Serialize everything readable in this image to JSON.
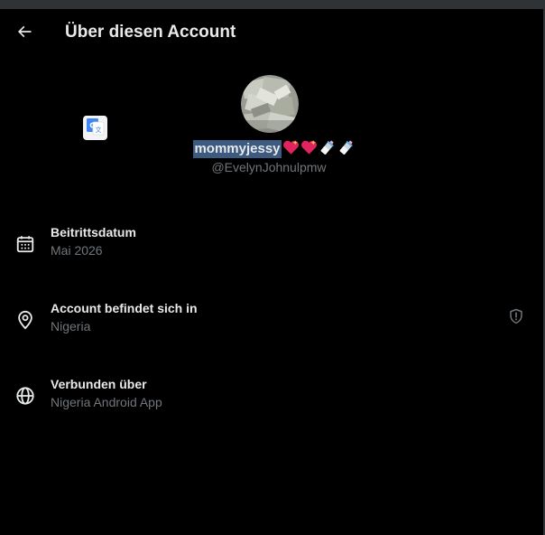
{
  "header": {
    "title": "Über diesen Account",
    "back_icon": "arrow-left-icon"
  },
  "profile": {
    "display_name": "mommyjessy",
    "name_emojis": [
      "💖",
      "💖",
      "🍼",
      "🍼"
    ],
    "handle": "@EvelynJohnulpmw",
    "avatar_icon": "profile-photo"
  },
  "translate": {
    "icon": "google-translate-icon"
  },
  "details": [
    {
      "icon": "calendar-icon",
      "label": "Beitrittsdatum",
      "value": "Mai 2026"
    },
    {
      "icon": "location-pin-icon",
      "label": "Account befindet sich in",
      "value": "Nigeria",
      "extra_icon": "shield-alert-icon"
    },
    {
      "icon": "globe-icon",
      "label": "Verbunden über",
      "value": "Nigeria Android App"
    }
  ],
  "colors": {
    "background": "#000000",
    "primary_text": "#e7e9ea",
    "secondary_text": "#71767b",
    "selection_highlight": "#3d5a80"
  }
}
